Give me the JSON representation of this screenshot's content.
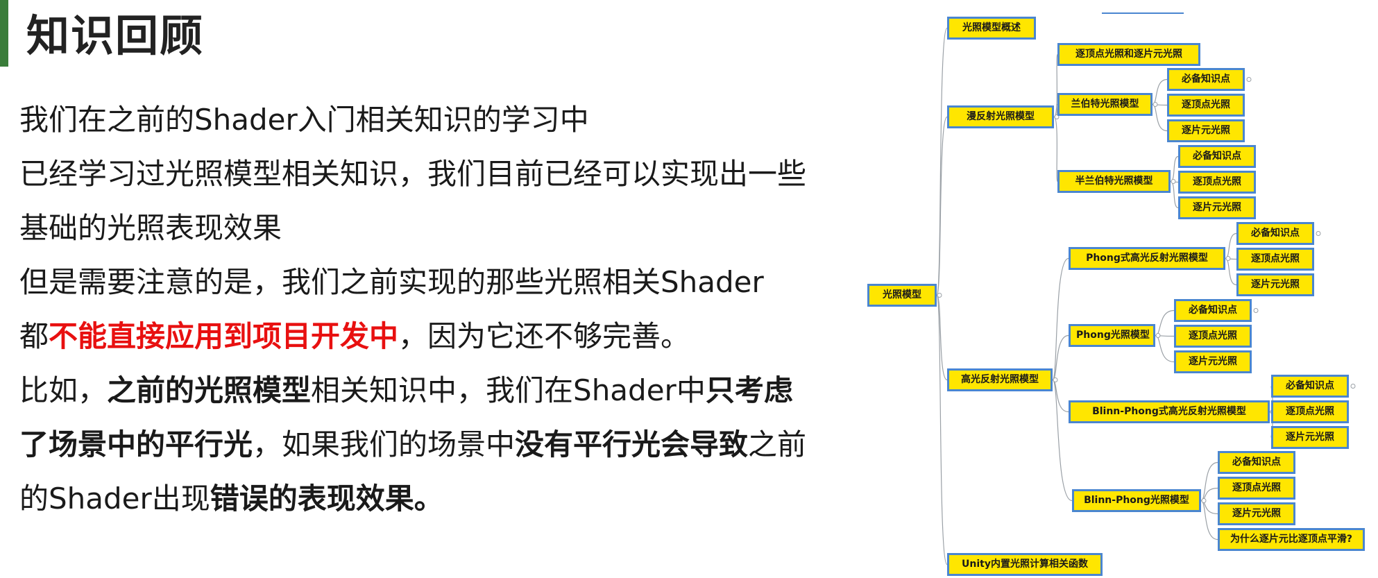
{
  "slide": {
    "title": "知识回顾",
    "lines": [
      [
        {
          "t": "我们在之前的Shader入门相关知识的学习中"
        }
      ],
      [
        {
          "t": "已经学习过光照模型相关知识，我们目前已经可以实现出一些"
        }
      ],
      [
        {
          "t": "基础的光照表现效果"
        }
      ],
      [
        {
          "t": "但是需要注意的是，我们之前实现的那些光照相关Shader"
        }
      ],
      [
        {
          "t": "都"
        },
        {
          "t": "不能直接应用到项目开发中",
          "s": "red"
        },
        {
          "t": "，因为它还不够完善。"
        }
      ],
      [
        {
          "t": "比如，"
        },
        {
          "t": "之前的光照模型",
          "s": "bold"
        },
        {
          "t": "相关知识中，我们在Shader中"
        },
        {
          "t": "只考虑",
          "s": "bold"
        }
      ],
      [
        {
          "t": "了场景中的平行光",
          "s": "bold"
        },
        {
          "t": "，如果我们的场景中"
        },
        {
          "t": "没有平行光会导致",
          "s": "bold"
        },
        {
          "t": "之前"
        }
      ],
      [
        {
          "t": "的Shader出现"
        },
        {
          "t": "错误的表现效果。",
          "s": "bold"
        }
      ]
    ]
  },
  "mindmap": {
    "root": "光照模型",
    "overview": "光照模型概述",
    "diffuse": "漫反射光照模型",
    "per_vertex_and_pixel": "逐顶点光照和逐片元光照",
    "lambert": "兰伯特光照模型",
    "half_lambert": "半兰伯特光照模型",
    "specular": "高光反射光照模型",
    "phong_reflect": "Phong式高光反射光照模型",
    "phong": "Phong光照模型",
    "blinn_phong_reflect": "Blinn-Phong式高光反射光照模型",
    "blinn_phong": "Blinn-Phong光照模型",
    "unity_funcs": "Unity内置光照计算相关函数",
    "leaf_must_know": "必备知识点",
    "leaf_vertex": "逐顶点光照",
    "leaf_pixel": "逐片元光照",
    "leaf_why": "为什么逐片元比逐顶点平滑?"
  }
}
